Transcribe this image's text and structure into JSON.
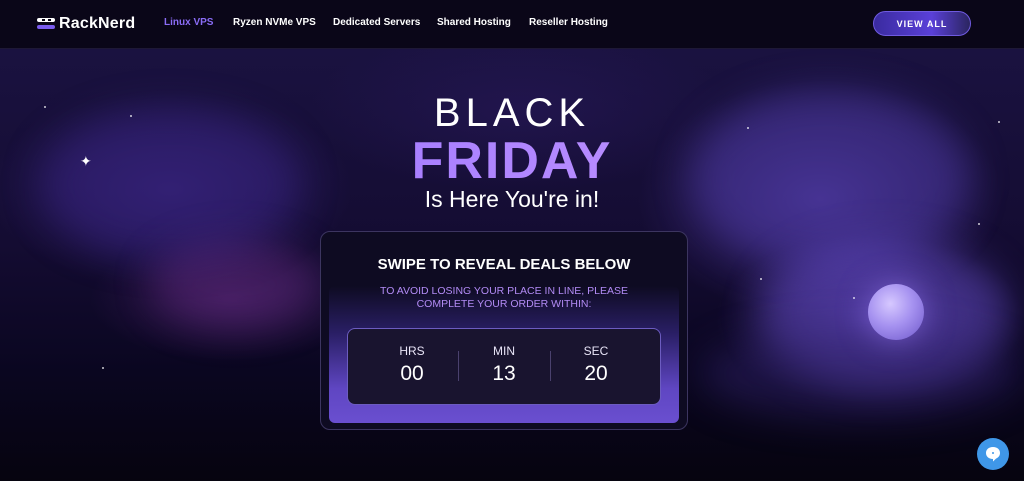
{
  "nav": {
    "brand": "RackNerd",
    "links": [
      "Linux VPS",
      "Ryzen NVMe VPS",
      "Dedicated Servers",
      "Shared Hosting",
      "Reseller Hosting"
    ],
    "active_link": "Linux VPS",
    "cta_label": "VIEW ALL"
  },
  "hero": {
    "title_line1": "BLACK",
    "title_line2": "FRIDAY",
    "subtitle": "Is Here You're in!"
  },
  "countdown": {
    "heading": "SWIPE TO REVEAL DEALS BELOW",
    "note_line1": "TO AVOID LOSING YOUR PLACE IN LINE, PLEASE",
    "note_line2": "COMPLETE YOUR ORDER WITHIN:",
    "hours_label": "HRS",
    "hours": "00",
    "minutes_label": "MIN",
    "minutes": "13",
    "seconds_label": "SEC",
    "seconds": "20"
  },
  "icons": {
    "logo": "racknerd-logo-icon",
    "chat": "chat-bubble-icon"
  },
  "colors": {
    "accent": "#7b5cf0",
    "active_link": "#8a6cf5",
    "chat_button": "#3f97e8",
    "note_text": "#b28bf5"
  }
}
